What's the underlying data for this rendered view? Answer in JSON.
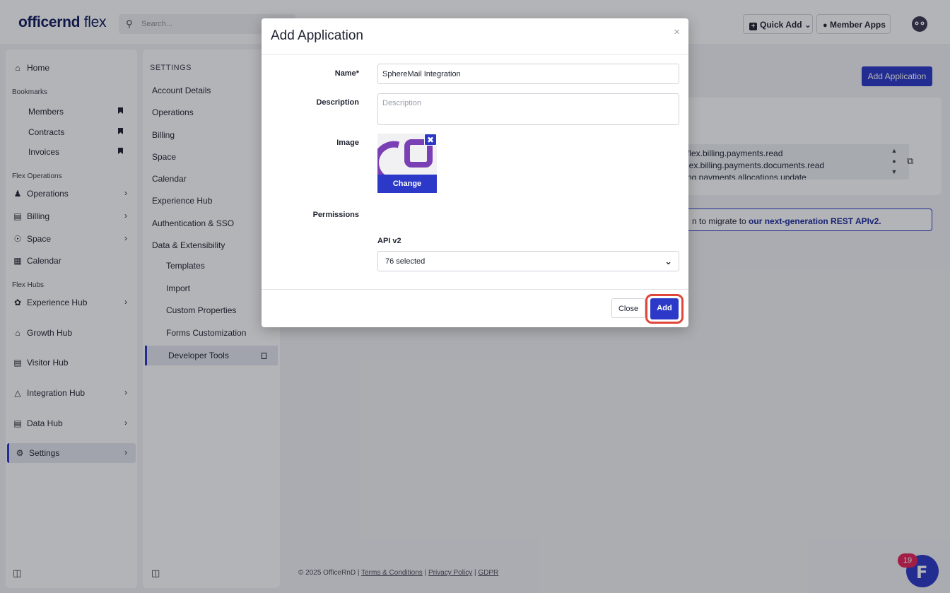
{
  "topbar": {
    "logo_brand": "officernd",
    "logo_product": "flex",
    "search_placeholder": "Search...",
    "quick_add_label": "Quick Add",
    "member_apps_label": "Member Apps"
  },
  "sidebar": {
    "home": "Home",
    "bookmarks_heading": "Bookmarks",
    "bookmarks": [
      "Members",
      "Contracts",
      "Invoices"
    ],
    "flex_operations_heading": "Flex Operations",
    "operations": "Operations",
    "billing": "Billing",
    "space": "Space",
    "calendar": "Calendar",
    "flex_hubs_heading": "Flex Hubs",
    "experience_hub": "Experience Hub",
    "growth_hub": "Growth Hub",
    "visitor_hub": "Visitor Hub",
    "integration_hub": "Integration Hub",
    "data_hub": "Data Hub",
    "settings": "Settings"
  },
  "settings_panel": {
    "heading": "SETTINGS",
    "items": [
      "Account Details",
      "Operations",
      "Billing",
      "Space",
      "Calendar",
      "Experience Hub",
      "Authentication & SSO",
      "Data & Extensibility"
    ],
    "sub_items": [
      "Templates",
      "Import",
      "Custom Properties",
      "Forms Customization",
      "Developer Tools"
    ]
  },
  "main": {
    "add_application_button": "Add Application",
    "scopes": [
      "flex.billing.payments.read",
      "lex.billing.payments.documents.read",
      "ng.payments.allocations.update"
    ],
    "banner_text": "n to migrate to ",
    "banner_link": "our next-generation REST APIv2."
  },
  "footer": {
    "copyright": "© 2025 OfficeRnD | ",
    "terms": "Terms & Conditions",
    "sep1": " | ",
    "privacy": "Privacy Policy",
    "sep2": " | ",
    "gdpr": "GDPR"
  },
  "chat": {
    "badge_count": "19"
  },
  "modal": {
    "title": "Add Application",
    "close_icon": "×",
    "name_label": "Name*",
    "name_value": "SphereMail Integration",
    "description_label": "Description",
    "description_placeholder": "Description",
    "image_label": "Image",
    "change_button": "Change",
    "permissions_label": "Permissions",
    "api_label": "API v2",
    "api_selected": "76 selected",
    "close_button": "Close",
    "add_button": "Add"
  },
  "colors": {
    "accent": "#2c39c8",
    "highlight_ring": "#e0463a",
    "logo_purple": "#7b3fb5",
    "badge": "#e8225a"
  }
}
